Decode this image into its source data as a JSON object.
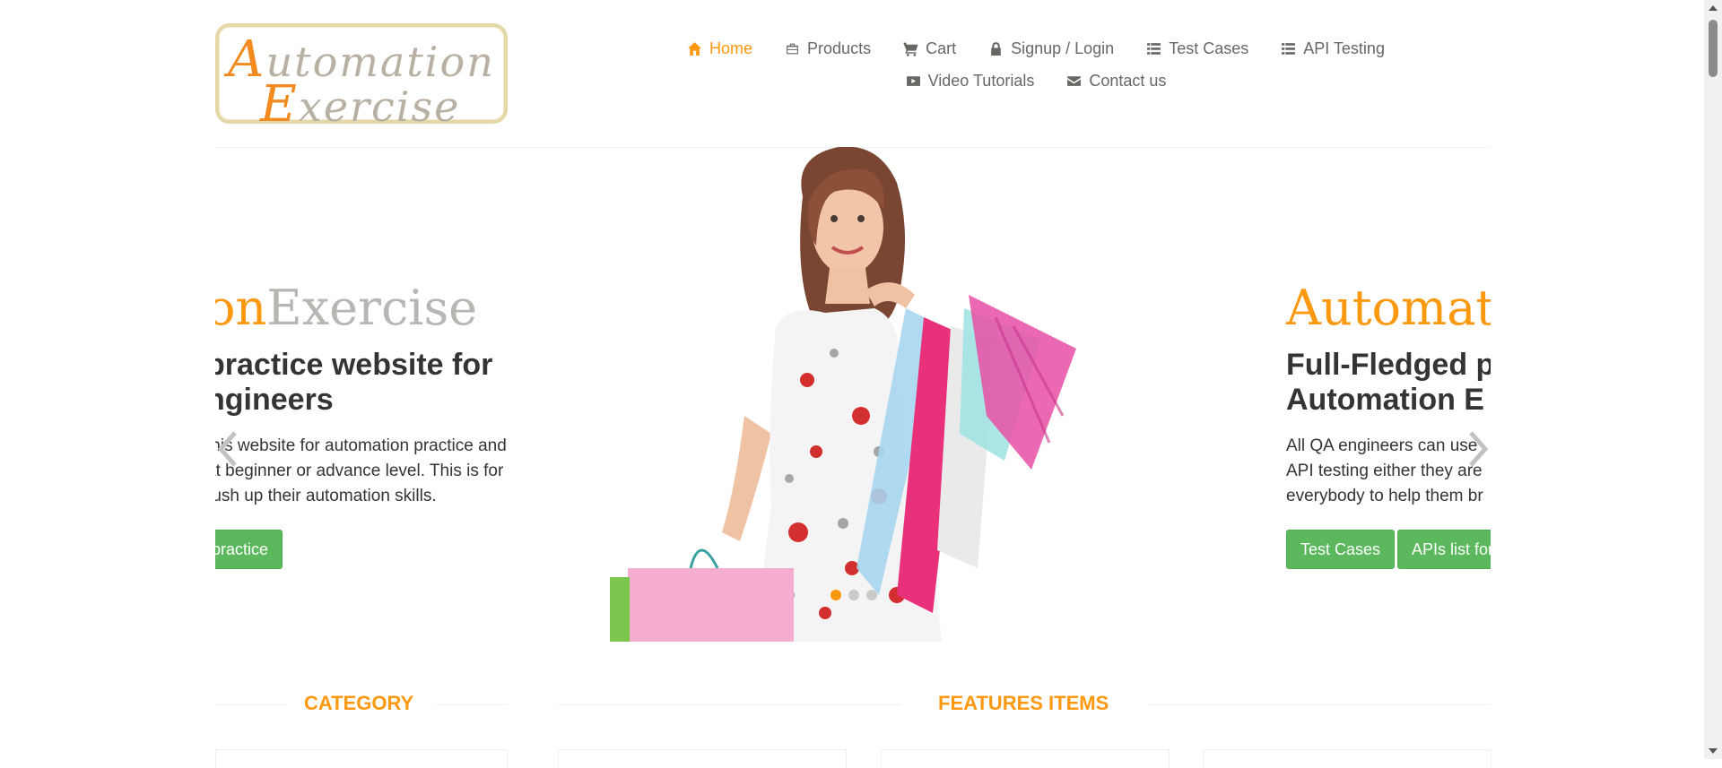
{
  "logo": {
    "line1": "utomation",
    "line1_cap": "A",
    "line2": "xercise",
    "line2_cap": "E"
  },
  "nav": {
    "items": [
      {
        "label": "Home",
        "icon": "home-icon"
      },
      {
        "label": "Products",
        "icon": "briefcase-icon"
      },
      {
        "label": "Cart",
        "icon": "cart-icon"
      },
      {
        "label": "Signup / Login",
        "icon": "lock-icon"
      },
      {
        "label": "Test Cases",
        "icon": "list-icon"
      },
      {
        "label": "API Testing",
        "icon": "list-icon"
      },
      {
        "label": "Video Tutorials",
        "icon": "youtube-play-icon"
      },
      {
        "label": "Contact us",
        "icon": "envelope-icon"
      }
    ],
    "active": "Home"
  },
  "slider": {
    "left_slide": {
      "brand_orange": "on",
      "brand_gray": "Exercise",
      "heading_line1": "practice website for",
      "heading_line2": "ngineers",
      "text_line1": "this website for automation practice and",
      "text_line2": "at beginner or advance level. This is for",
      "text_line3": "rush up their automation skills.",
      "button": "practice"
    },
    "right_slide": {
      "brand_orange": "Automati",
      "heading_line1": "Full-Fledged p",
      "heading_line2": "Automation E",
      "text_line1": "All QA engineers can use",
      "text_line2": "API testing either they are",
      "text_line3": "everybody to help them br",
      "button1": "Test Cases",
      "button2": "APIs list for"
    },
    "prev_icon": "chevron-left-icon",
    "next_icon": "chevron-right-icon",
    "dots": 3,
    "active_dot": 1
  },
  "sections": {
    "category": "CATEGORY",
    "features": "FEATURES ITEMS"
  },
  "colors": {
    "accent": "#fe980f",
    "button": "#5cb85c",
    "heading": "#363432",
    "text": "#696763"
  }
}
